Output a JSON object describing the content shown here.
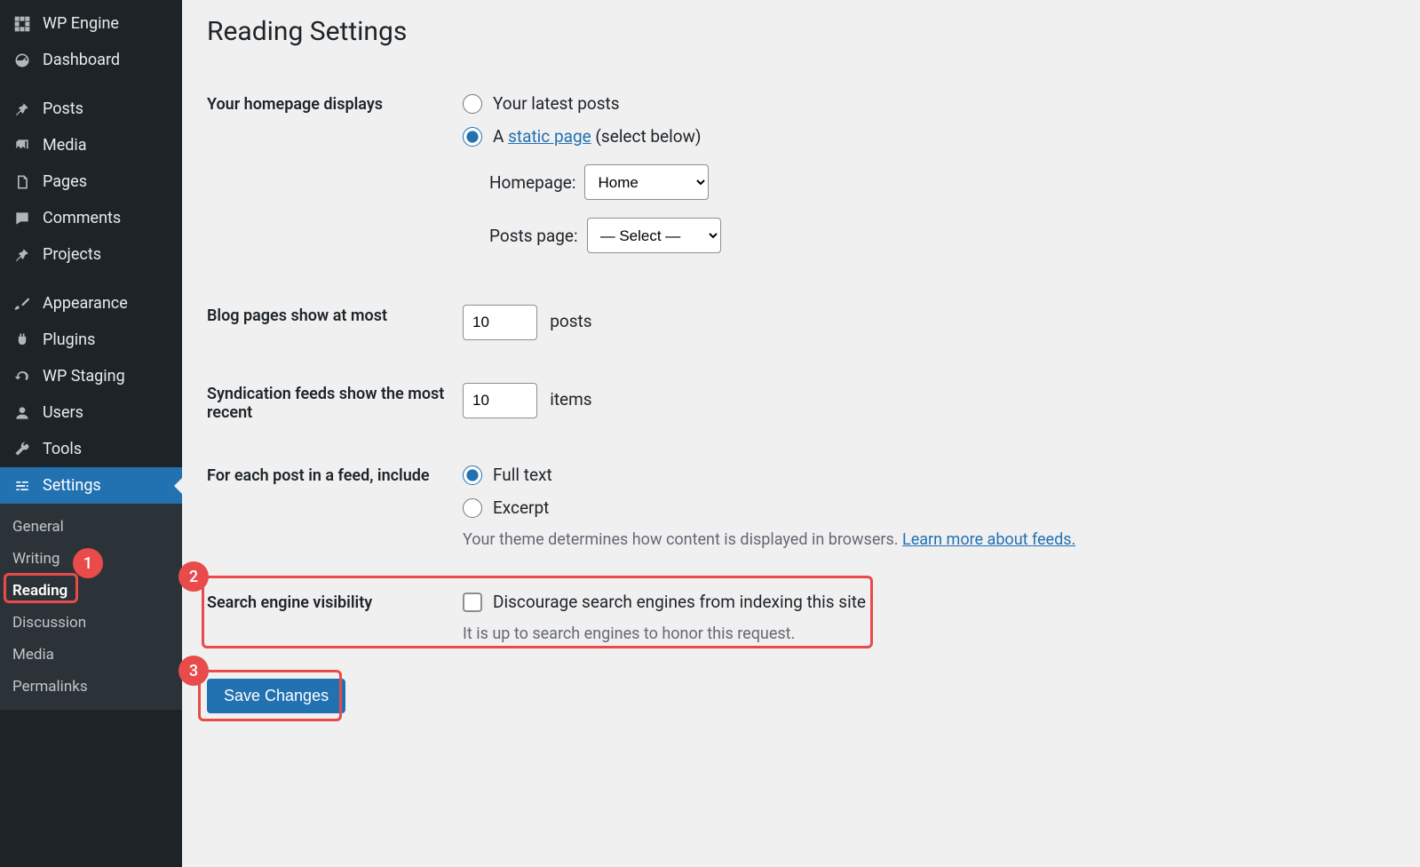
{
  "sidebar": {
    "items": [
      {
        "label": "WP Engine"
      },
      {
        "label": "Dashboard"
      },
      {
        "label": "Posts"
      },
      {
        "label": "Media"
      },
      {
        "label": "Pages"
      },
      {
        "label": "Comments"
      },
      {
        "label": "Projects"
      },
      {
        "label": "Appearance"
      },
      {
        "label": "Plugins"
      },
      {
        "label": "WP Staging"
      },
      {
        "label": "Users"
      },
      {
        "label": "Tools"
      },
      {
        "label": "Settings"
      }
    ],
    "submenu": [
      {
        "label": "General"
      },
      {
        "label": "Writing"
      },
      {
        "label": "Reading"
      },
      {
        "label": "Discussion"
      },
      {
        "label": "Media"
      },
      {
        "label": "Permalinks"
      }
    ]
  },
  "page": {
    "title": "Reading Settings"
  },
  "homepage": {
    "label": "Your homepage displays",
    "opt_latest": "Your latest posts",
    "opt_static_prefix": "A ",
    "opt_static_link": "static page",
    "opt_static_suffix": " (select below)",
    "homepage_label": "Homepage:",
    "homepage_value": "Home",
    "postspage_label": "Posts page:",
    "postspage_value": "— Select —"
  },
  "blog_pages": {
    "label": "Blog pages show at most",
    "value": "10",
    "unit": "posts"
  },
  "syndication": {
    "label": "Syndication feeds show the most recent",
    "value": "10",
    "unit": "items"
  },
  "feed_content": {
    "label": "For each post in a feed, include",
    "opt_full": "Full text",
    "opt_excerpt": "Excerpt",
    "desc_prefix": "Your theme determines how content is displayed in browsers. ",
    "desc_link": "Learn more about feeds."
  },
  "seo": {
    "label": "Search engine visibility",
    "checkbox_label": "Discourage search engines from indexing this site",
    "desc": "It is up to search engines to honor this request."
  },
  "save": {
    "label": "Save Changes"
  },
  "annotations": {
    "b1": "1",
    "b2": "2",
    "b3": "3"
  }
}
